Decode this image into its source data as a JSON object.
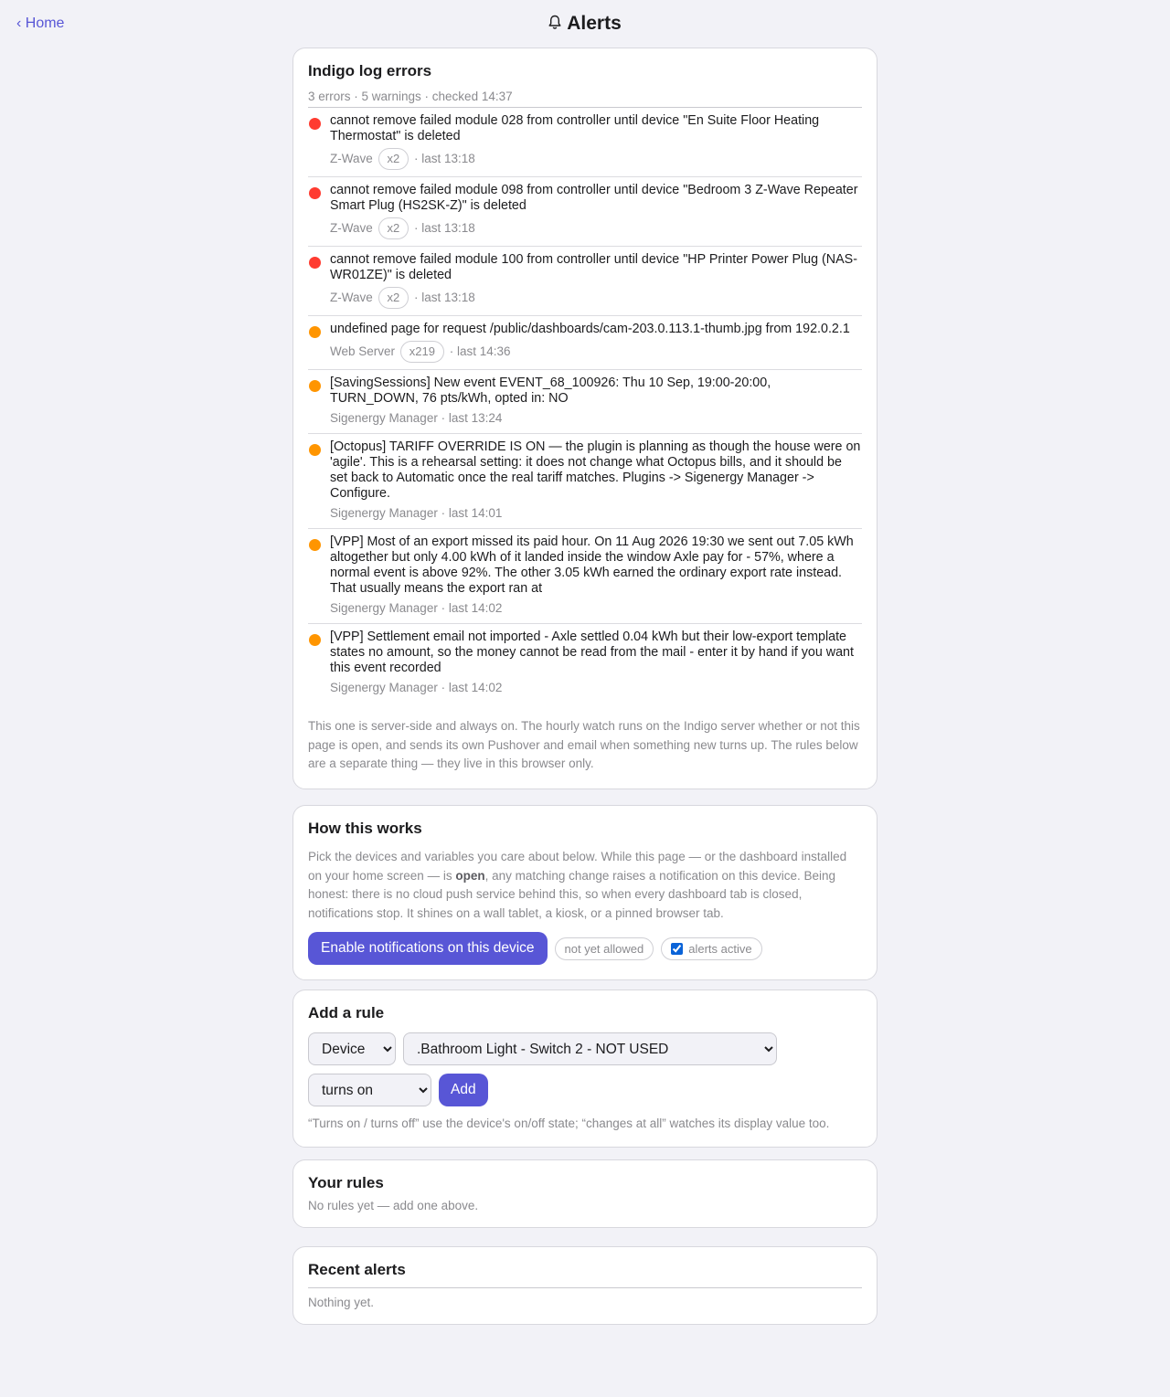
{
  "nav": {
    "home_label": "‹ Home"
  },
  "header": {
    "title": "Alerts",
    "icon": "bell-icon"
  },
  "log_card": {
    "title": "Indigo log errors",
    "summary": "3 errors · 5 warnings · checked 14:37",
    "items": [
      {
        "level": "error",
        "message": "cannot remove failed module 028 from controller until device \"En Suite Floor Heating Thermostat\" is deleted",
        "source": "Z-Wave",
        "count": "x2",
        "last": "· last 13:18"
      },
      {
        "level": "error",
        "message": "cannot remove failed module 098 from controller until device \"Bedroom 3 Z-Wave Repeater Smart Plug (HS2SK-Z)\" is deleted",
        "source": "Z-Wave",
        "count": "x2",
        "last": "· last 13:18"
      },
      {
        "level": "error",
        "message": "cannot remove failed module 100 from controller until device \"HP Printer Power Plug (NAS-WR01ZE)\" is deleted",
        "source": "Z-Wave",
        "count": "x2",
        "last": "· last 13:18"
      },
      {
        "level": "warning",
        "message": "undefined page for request /public/dashboards/cam-203.0.113.1-thumb.jpg from 192.0.2.1",
        "source": "Web Server",
        "count": "x219",
        "last": "· last 14:36"
      },
      {
        "level": "warning",
        "message": "[SavingSessions] New event EVENT_68_100926: Thu 10 Sep, 19:00-20:00, TURN_DOWN, 76 pts/kWh, opted in: NO",
        "source": "Sigenergy Manager",
        "count": "",
        "last": "· last 13:24"
      },
      {
        "level": "warning",
        "message": "[Octopus] TARIFF OVERRIDE IS ON — the plugin is planning as though the house were on 'agile'. This is a rehearsal setting: it does not change what Octopus bills, and it should be set back to Automatic once the real tariff matches. Plugins -> Sigenergy Manager -> Configure.",
        "source": "Sigenergy Manager",
        "count": "",
        "last": "· last 14:01"
      },
      {
        "level": "warning",
        "message": "[VPP] Most of an export missed its paid hour. On 11 Aug 2026 19:30 we sent out 7.05 kWh altogether but only 4.00 kWh of it landed inside the window Axle pay for - 57%, where a normal event is above 92%. The other 3.05 kWh earned the ordinary export rate instead. That usually means the export ran at",
        "source": "Sigenergy Manager",
        "count": "",
        "last": "· last 14:02"
      },
      {
        "level": "warning",
        "message": "[VPP] Settlement email not imported - Axle settled 0.04 kWh but their low-export template states no amount, so the money cannot be read from the mail - enter it by hand if you want this event recorded",
        "source": "Sigenergy Manager",
        "count": "",
        "last": "· last 14:02"
      }
    ],
    "footnote": "This one is server-side and always on. The hourly watch runs on the Indigo server whether or not this page is open, and sends its own Pushover and email when something new turns up. The rules below are a separate thing — they live in this browser only."
  },
  "how_card": {
    "title": "How this works",
    "text_before": "Pick the devices and variables you care about below. While this page — or the dashboard installed on your home screen — is ",
    "text_bold": "open",
    "text_after": ", any matching change raises a notification on this device. Being honest: there is no cloud push service behind this, so when every dashboard tab is closed, notifications stop. It shines on a wall tablet, a kiosk, or a pinned browser tab.",
    "enable_button": "Enable notifications on this device",
    "permission_status": "not yet allowed",
    "alerts_active_label": "alerts active",
    "alerts_active_checked": true
  },
  "add_card": {
    "title": "Add a rule",
    "type_selected": "Device",
    "target_selected": ".Bathroom Light - Switch 2 - NOT USED",
    "condition_selected": "turns on",
    "add_button": "Add",
    "hint": "“Turns on / turns off” use the device's on/off state; “changes at all” watches its display value too."
  },
  "rules_card": {
    "title": "Your rules",
    "empty": "No rules yet — add one above."
  },
  "recent_card": {
    "title": "Recent alerts",
    "empty": "Nothing yet."
  },
  "colors": {
    "accent": "#5856d6",
    "error": "#ff3b30",
    "warning": "#ff9500",
    "background": "#f2f2f7"
  }
}
